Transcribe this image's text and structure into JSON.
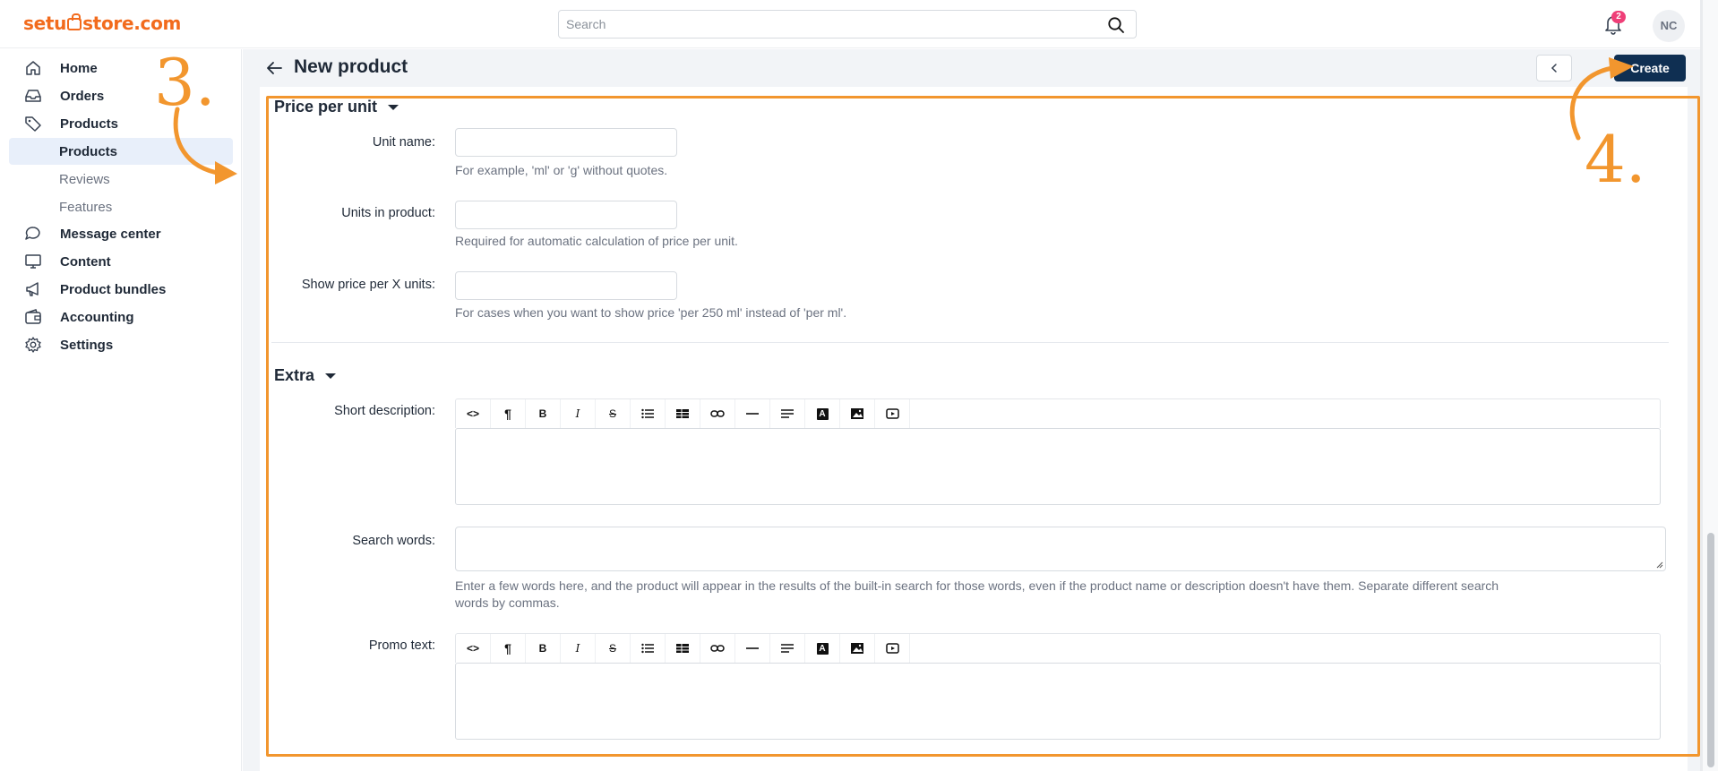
{
  "app": {
    "logo_text_left": "setu",
    "logo_text_right": "store.com"
  },
  "header": {
    "search_placeholder": "Search",
    "notification_count": "2",
    "avatar_initials": "NC"
  },
  "sidebar": {
    "items": [
      {
        "label": "Home",
        "icon": "home-icon"
      },
      {
        "label": "Orders",
        "icon": "inbox-icon"
      },
      {
        "label": "Products",
        "icon": "tag-icon"
      },
      {
        "label": "Message center",
        "icon": "chat-bubble-icon"
      },
      {
        "label": "Content",
        "icon": "monitor-icon"
      },
      {
        "label": "Product bundles",
        "icon": "megaphone-icon"
      },
      {
        "label": "Accounting",
        "icon": "wallet-icon"
      },
      {
        "label": "Settings",
        "icon": "gear-icon"
      }
    ],
    "sub_items": [
      {
        "label": "Products",
        "active": true
      },
      {
        "label": "Reviews",
        "active": false
      },
      {
        "label": "Features",
        "active": false
      }
    ]
  },
  "page": {
    "title": "New product",
    "create_label": "Create"
  },
  "price_per_unit": {
    "title": "Price per unit",
    "fields": [
      {
        "label": "Unit name:",
        "value": "",
        "hint": "For example, 'ml' or 'g' without quotes."
      },
      {
        "label": "Units in product:",
        "value": "",
        "hint": "Required for automatic calculation of price per unit."
      },
      {
        "label": "Show price per X units:",
        "value": "",
        "hint": "For cases when you want to show price 'per 250 ml' instead of 'per ml'."
      }
    ]
  },
  "extra": {
    "title": "Extra",
    "short_description_label": "Short description:",
    "search_words_label": "Search words:",
    "search_words_value": "",
    "search_words_hint_line1": "Enter a few words here, and the product will appear in the results of the built-in search for those words, even if the product name or description doesn't have them. Separate different search",
    "search_words_hint_line2": "words by commas.",
    "promo_text_label": "Promo text:",
    "toolbar_buttons": [
      {
        "name": "code-view-icon",
        "glyph": "<>"
      },
      {
        "name": "paragraph-icon",
        "glyph": "¶"
      },
      {
        "name": "bold-icon",
        "glyph": "B"
      },
      {
        "name": "italic-icon",
        "glyph": "I"
      },
      {
        "name": "strikethrough-icon",
        "glyph": "S"
      },
      {
        "name": "bulleted-list-icon",
        "glyph": ""
      },
      {
        "name": "table-icon",
        "glyph": ""
      },
      {
        "name": "link-icon",
        "glyph": ""
      },
      {
        "name": "horizontal-rule-icon",
        "glyph": ""
      },
      {
        "name": "align-icon",
        "glyph": ""
      },
      {
        "name": "font-color-icon",
        "glyph": "A"
      },
      {
        "name": "image-icon",
        "glyph": ""
      },
      {
        "name": "video-icon",
        "glyph": ""
      }
    ]
  },
  "annotations": {
    "step3": "3.",
    "step4": "4.",
    "color": "#f2962e"
  },
  "colors": {
    "brand": "#f26b1d",
    "primary_button": "#0f2f52",
    "badge": "#ef3f78",
    "active_nav_bg": "#e8effa"
  }
}
